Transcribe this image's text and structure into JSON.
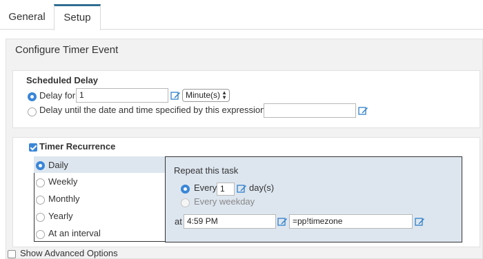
{
  "tabs": [
    {
      "label": "General"
    },
    {
      "label": "Setup"
    }
  ],
  "panel": {
    "title": "Configure Timer Event"
  },
  "scheduled_delay": {
    "title": "Scheduled Delay",
    "delay_for": {
      "label": "Delay for",
      "value": "1",
      "unit": "Minute(s)",
      "selected": true
    },
    "delay_until": {
      "label": "Delay until the date and time specified by this expression:",
      "value": ""
    }
  },
  "timer_recurrence": {
    "title": "Timer Recurrence",
    "checked": true,
    "options": [
      {
        "label": "Daily",
        "selected": true
      },
      {
        "label": "Weekly"
      },
      {
        "label": "Monthly"
      },
      {
        "label": "Yearly"
      },
      {
        "label": "At an interval"
      }
    ],
    "detail": {
      "heading": "Repeat this task",
      "every": {
        "label": "Every",
        "value": "1",
        "suffix": "day(s)"
      },
      "every_weekday": {
        "label": "Every weekday"
      },
      "at_label": "at",
      "time": "4:59 PM",
      "timezone": "=pp!timezone"
    }
  },
  "advanced": {
    "label": "Show Advanced Options",
    "checked": false
  },
  "colors": {
    "accent": "#3a86d8",
    "tab_border": "#2f6e8f",
    "selected_bg": "#dde6ef",
    "panel_bg": "#f2f2f2"
  }
}
